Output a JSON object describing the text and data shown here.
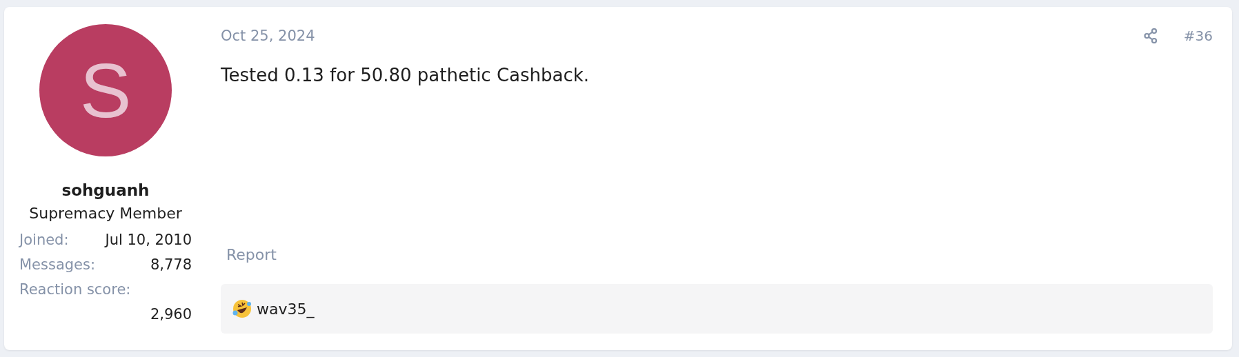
{
  "user": {
    "avatar_letter": "S",
    "name": "sohguanh",
    "title": "Supremacy Member",
    "stats": [
      {
        "label": "Joined:",
        "value": "Jul 10, 2010",
        "stacked": false
      },
      {
        "label": "Messages:",
        "value": "8,778",
        "stacked": false
      },
      {
        "label": "Reaction score:",
        "value": "2,960",
        "stacked": true
      }
    ]
  },
  "post": {
    "date": "Oct 25, 2024",
    "number": "#36",
    "message": "Tested 0.13 for 50.80 pathetic Cashback.",
    "report": "Report",
    "reactions": {
      "users": "wav35_"
    }
  }
}
